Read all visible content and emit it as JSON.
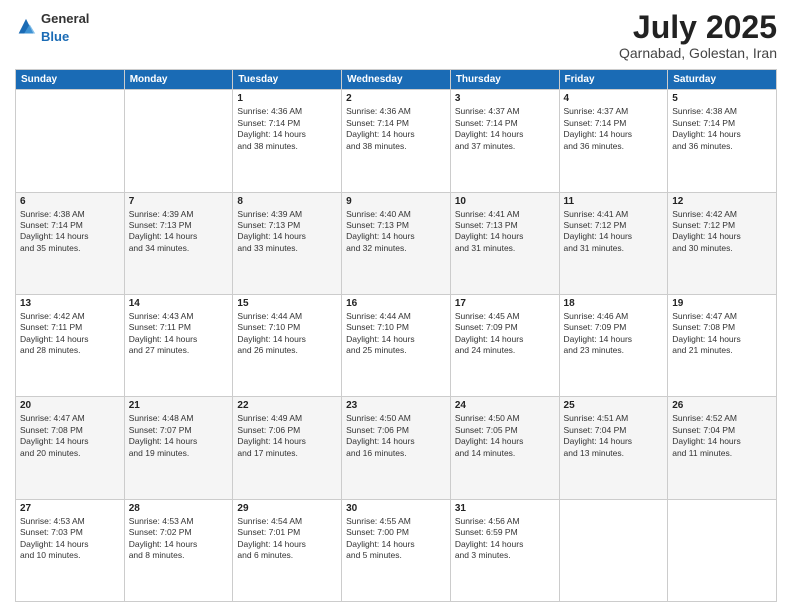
{
  "header": {
    "logo_general": "General",
    "logo_blue": "Blue",
    "month": "July 2025",
    "location": "Qarnabad, Golestan, Iran"
  },
  "days_of_week": [
    "Sunday",
    "Monday",
    "Tuesday",
    "Wednesday",
    "Thursday",
    "Friday",
    "Saturday"
  ],
  "weeks": [
    [
      {
        "day": "",
        "info": ""
      },
      {
        "day": "",
        "info": ""
      },
      {
        "day": "1",
        "info": "Sunrise: 4:36 AM\nSunset: 7:14 PM\nDaylight: 14 hours\nand 38 minutes."
      },
      {
        "day": "2",
        "info": "Sunrise: 4:36 AM\nSunset: 7:14 PM\nDaylight: 14 hours\nand 38 minutes."
      },
      {
        "day": "3",
        "info": "Sunrise: 4:37 AM\nSunset: 7:14 PM\nDaylight: 14 hours\nand 37 minutes."
      },
      {
        "day": "4",
        "info": "Sunrise: 4:37 AM\nSunset: 7:14 PM\nDaylight: 14 hours\nand 36 minutes."
      },
      {
        "day": "5",
        "info": "Sunrise: 4:38 AM\nSunset: 7:14 PM\nDaylight: 14 hours\nand 36 minutes."
      }
    ],
    [
      {
        "day": "6",
        "info": "Sunrise: 4:38 AM\nSunset: 7:14 PM\nDaylight: 14 hours\nand 35 minutes."
      },
      {
        "day": "7",
        "info": "Sunrise: 4:39 AM\nSunset: 7:13 PM\nDaylight: 14 hours\nand 34 minutes."
      },
      {
        "day": "8",
        "info": "Sunrise: 4:39 AM\nSunset: 7:13 PM\nDaylight: 14 hours\nand 33 minutes."
      },
      {
        "day": "9",
        "info": "Sunrise: 4:40 AM\nSunset: 7:13 PM\nDaylight: 14 hours\nand 32 minutes."
      },
      {
        "day": "10",
        "info": "Sunrise: 4:41 AM\nSunset: 7:13 PM\nDaylight: 14 hours\nand 31 minutes."
      },
      {
        "day": "11",
        "info": "Sunrise: 4:41 AM\nSunset: 7:12 PM\nDaylight: 14 hours\nand 31 minutes."
      },
      {
        "day": "12",
        "info": "Sunrise: 4:42 AM\nSunset: 7:12 PM\nDaylight: 14 hours\nand 30 minutes."
      }
    ],
    [
      {
        "day": "13",
        "info": "Sunrise: 4:42 AM\nSunset: 7:11 PM\nDaylight: 14 hours\nand 28 minutes."
      },
      {
        "day": "14",
        "info": "Sunrise: 4:43 AM\nSunset: 7:11 PM\nDaylight: 14 hours\nand 27 minutes."
      },
      {
        "day": "15",
        "info": "Sunrise: 4:44 AM\nSunset: 7:10 PM\nDaylight: 14 hours\nand 26 minutes."
      },
      {
        "day": "16",
        "info": "Sunrise: 4:44 AM\nSunset: 7:10 PM\nDaylight: 14 hours\nand 25 minutes."
      },
      {
        "day": "17",
        "info": "Sunrise: 4:45 AM\nSunset: 7:09 PM\nDaylight: 14 hours\nand 24 minutes."
      },
      {
        "day": "18",
        "info": "Sunrise: 4:46 AM\nSunset: 7:09 PM\nDaylight: 14 hours\nand 23 minutes."
      },
      {
        "day": "19",
        "info": "Sunrise: 4:47 AM\nSunset: 7:08 PM\nDaylight: 14 hours\nand 21 minutes."
      }
    ],
    [
      {
        "day": "20",
        "info": "Sunrise: 4:47 AM\nSunset: 7:08 PM\nDaylight: 14 hours\nand 20 minutes."
      },
      {
        "day": "21",
        "info": "Sunrise: 4:48 AM\nSunset: 7:07 PM\nDaylight: 14 hours\nand 19 minutes."
      },
      {
        "day": "22",
        "info": "Sunrise: 4:49 AM\nSunset: 7:06 PM\nDaylight: 14 hours\nand 17 minutes."
      },
      {
        "day": "23",
        "info": "Sunrise: 4:50 AM\nSunset: 7:06 PM\nDaylight: 14 hours\nand 16 minutes."
      },
      {
        "day": "24",
        "info": "Sunrise: 4:50 AM\nSunset: 7:05 PM\nDaylight: 14 hours\nand 14 minutes."
      },
      {
        "day": "25",
        "info": "Sunrise: 4:51 AM\nSunset: 7:04 PM\nDaylight: 14 hours\nand 13 minutes."
      },
      {
        "day": "26",
        "info": "Sunrise: 4:52 AM\nSunset: 7:04 PM\nDaylight: 14 hours\nand 11 minutes."
      }
    ],
    [
      {
        "day": "27",
        "info": "Sunrise: 4:53 AM\nSunset: 7:03 PM\nDaylight: 14 hours\nand 10 minutes."
      },
      {
        "day": "28",
        "info": "Sunrise: 4:53 AM\nSunset: 7:02 PM\nDaylight: 14 hours\nand 8 minutes."
      },
      {
        "day": "29",
        "info": "Sunrise: 4:54 AM\nSunset: 7:01 PM\nDaylight: 14 hours\nand 6 minutes."
      },
      {
        "day": "30",
        "info": "Sunrise: 4:55 AM\nSunset: 7:00 PM\nDaylight: 14 hours\nand 5 minutes."
      },
      {
        "day": "31",
        "info": "Sunrise: 4:56 AM\nSunset: 6:59 PM\nDaylight: 14 hours\nand 3 minutes."
      },
      {
        "day": "",
        "info": ""
      },
      {
        "day": "",
        "info": ""
      }
    ]
  ]
}
